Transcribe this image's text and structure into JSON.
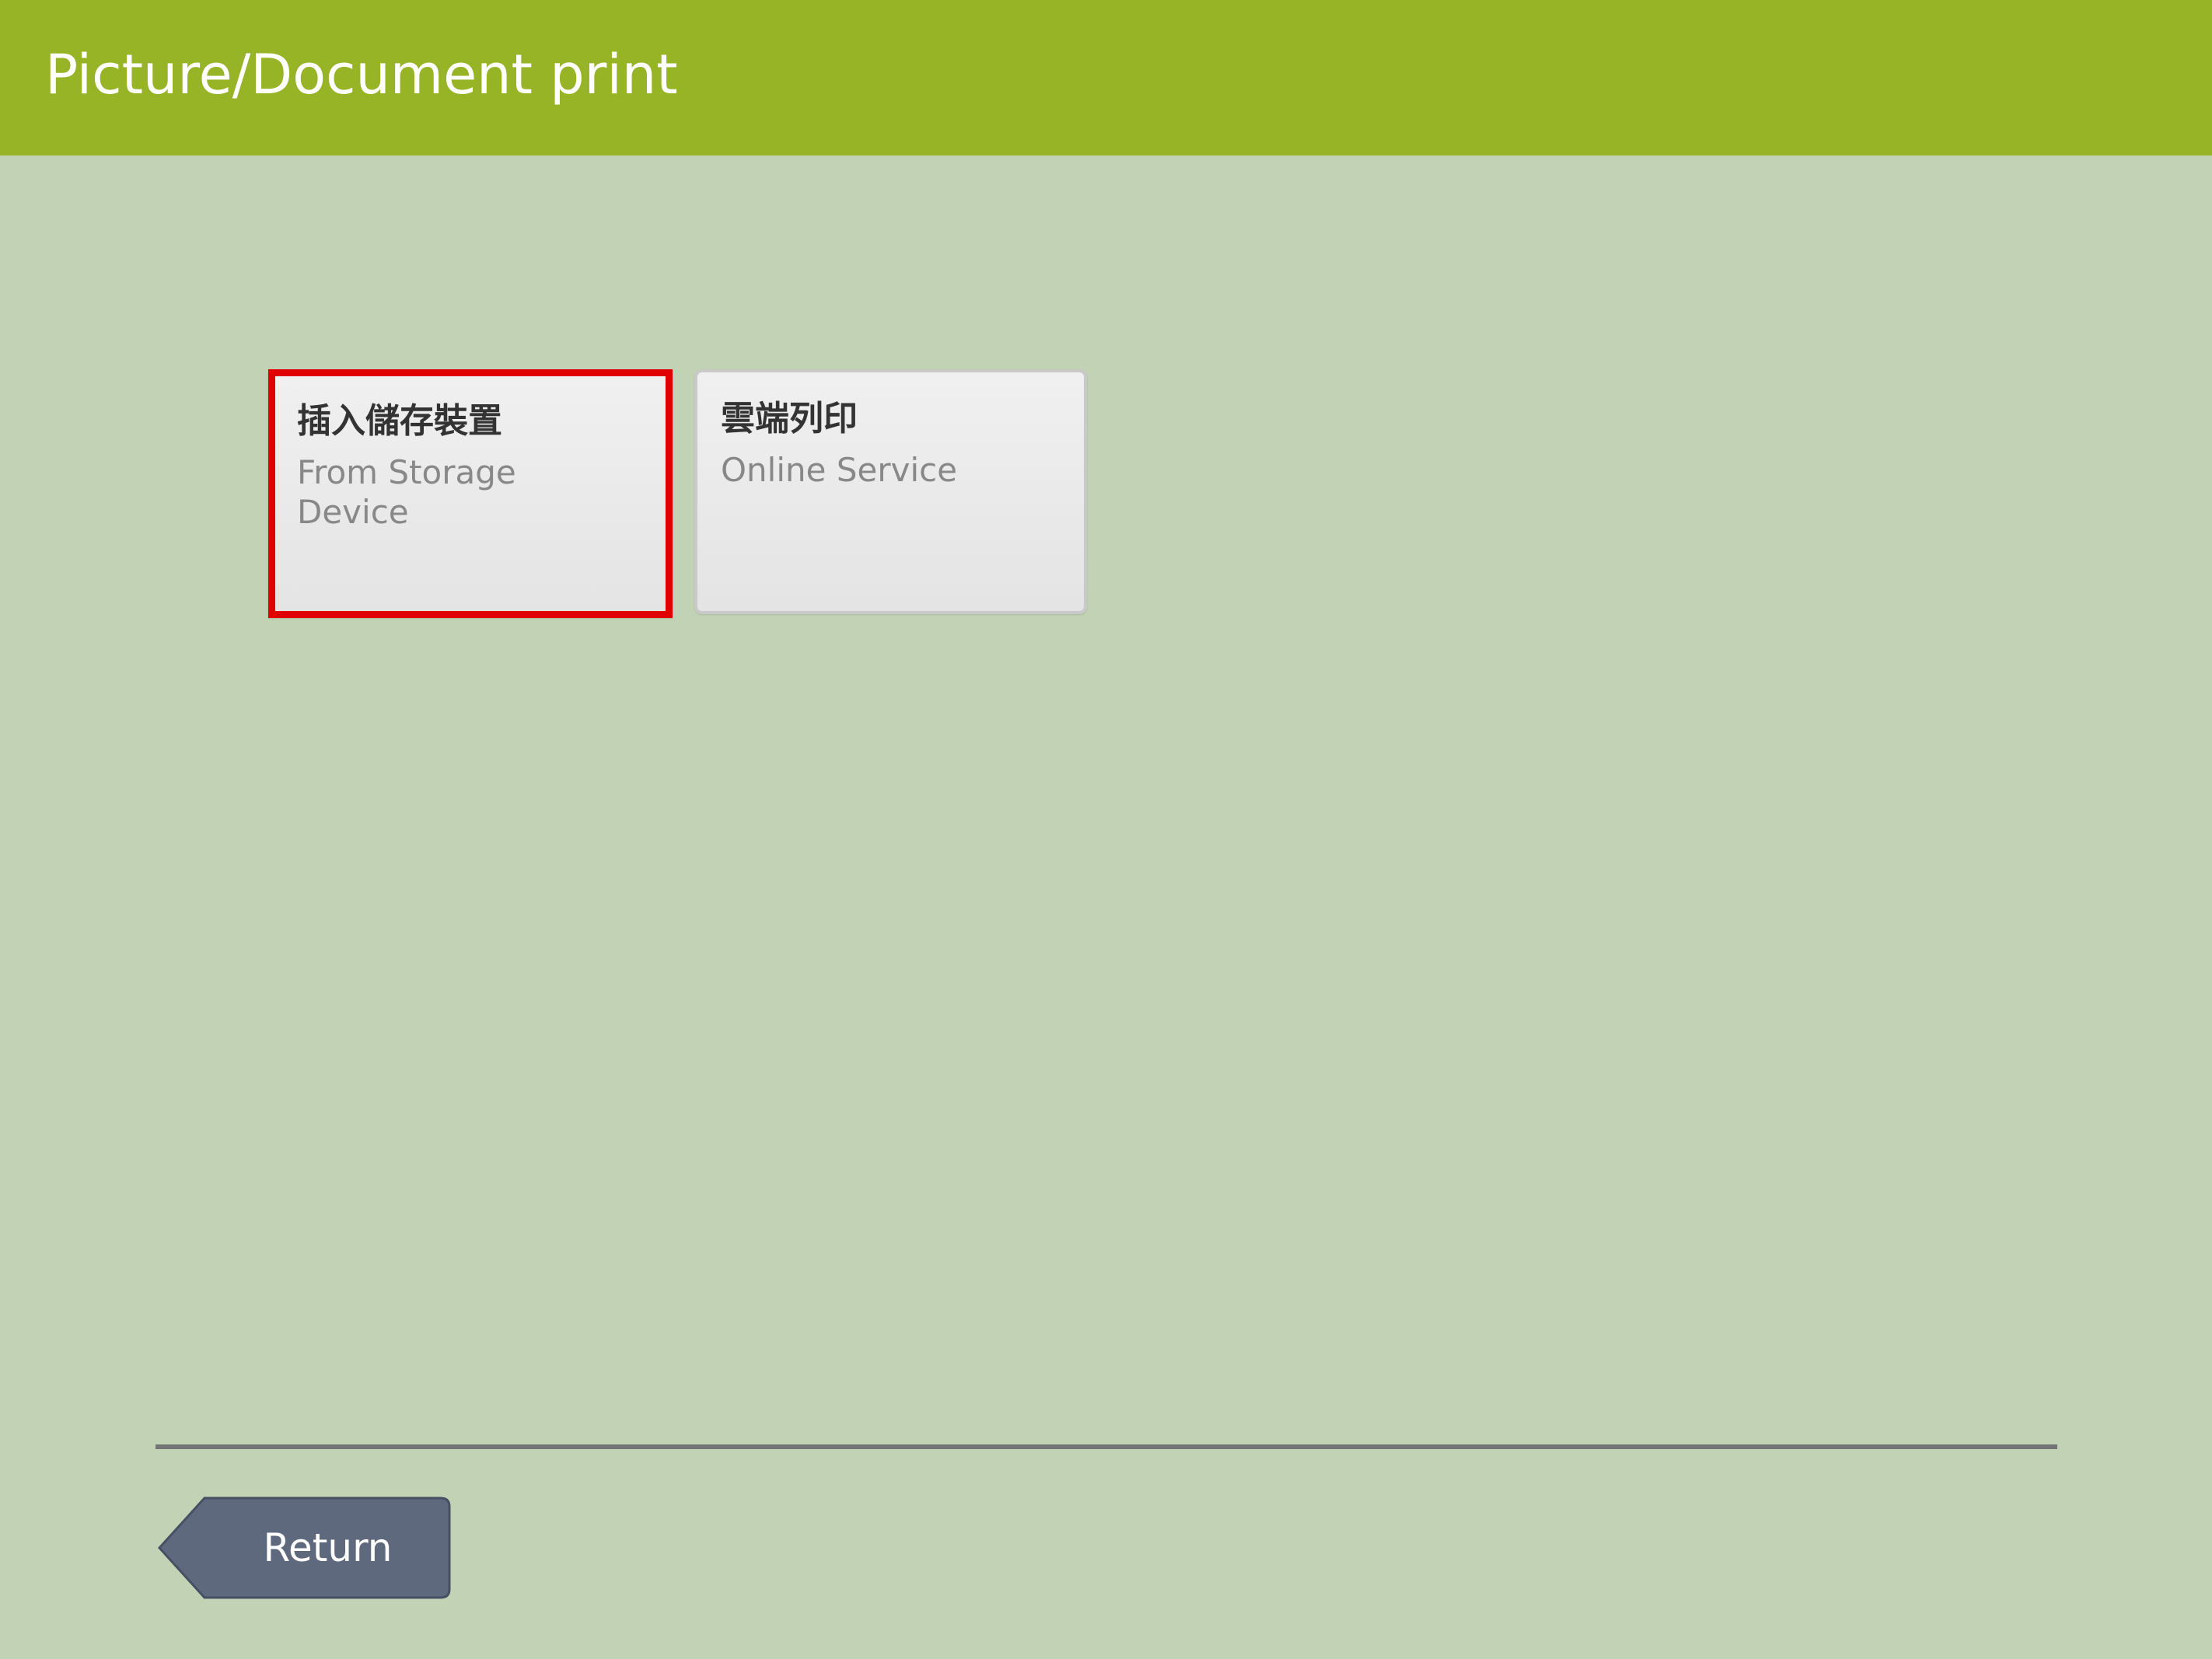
{
  "header": {
    "title": "Picture/Document print"
  },
  "options": [
    {
      "title": "插入儲存裝置",
      "subtitle": "From Storage Device",
      "selected": true
    },
    {
      "title": "雲端列印",
      "subtitle": "Online Service",
      "selected": false
    }
  ],
  "footer": {
    "return_label": "Return"
  },
  "colors": {
    "header_bg": "#97b326",
    "page_bg": "#c1d2b5",
    "selection_border": "#e00000",
    "return_button_bg": "#5f697e"
  }
}
